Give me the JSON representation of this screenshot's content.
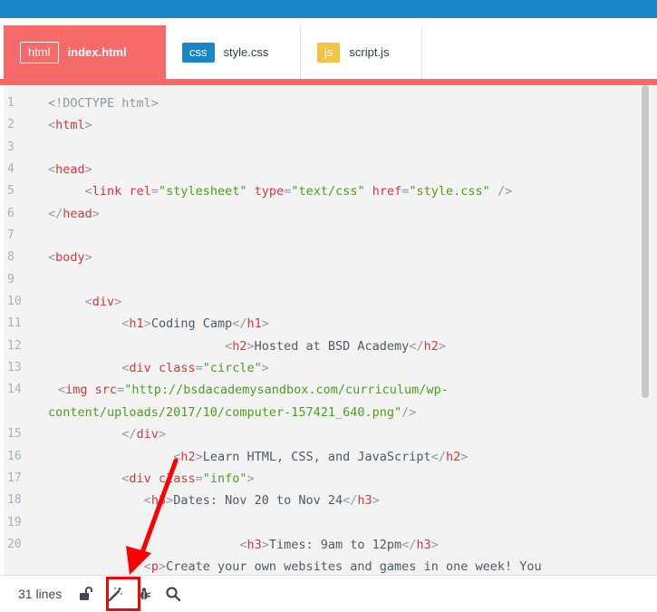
{
  "tabs": [
    {
      "badge": "html",
      "label": "index.html",
      "active": true,
      "badge_color": "#f76a6a"
    },
    {
      "badge": "css",
      "label": "style.css",
      "active": false,
      "badge_color": "#1a86c8"
    },
    {
      "badge": "js",
      "label": "script.js",
      "active": false,
      "badge_color": "#f5c343"
    }
  ],
  "code_lines": [
    {
      "n": "1"
    },
    {
      "n": "2"
    },
    {
      "n": "3"
    },
    {
      "n": "4"
    },
    {
      "n": "5"
    },
    {
      "n": "6"
    },
    {
      "n": "7"
    },
    {
      "n": "8"
    },
    {
      "n": "9"
    },
    {
      "n": "10"
    },
    {
      "n": "11"
    },
    {
      "n": "12"
    },
    {
      "n": "13"
    },
    {
      "n": "14"
    },
    {
      "n": "15"
    },
    {
      "n": "16"
    },
    {
      "n": "17"
    },
    {
      "n": "18"
    },
    {
      "n": "19"
    },
    {
      "n": "20"
    }
  ],
  "code": {
    "l1": {
      "a": "<!DOCTYPE html>"
    },
    "l5": {
      "attr1": "rel",
      "val1": "\"stylesheet\"",
      "attr2": "type",
      "val2": "\"text/css\"",
      "attr3": "href",
      "val3": "\"style.css\""
    },
    "l11": {
      "text": "Coding Camp"
    },
    "l12": {
      "text": "Hosted at BSD Academy"
    },
    "l13": {
      "attr": "class",
      "val": "\"circle\""
    },
    "l14": {
      "attr": "src",
      "val_a": "\"http://bsdacademysandbox.com/curriculum/wp-",
      "val_b": "content/uploads/2017/10/computer-157421_640.png\""
    },
    "l16": {
      "text": "Learn HTML, CSS, and JavaScript"
    },
    "l17": {
      "attr": "class",
      "val": "\"info\""
    },
    "l18": {
      "text": "Dates: Nov 20 to Nov 24"
    },
    "l20": {
      "text": "Times: 9am to 12pm"
    },
    "l21": {
      "text": "Create your own websites and games in one week! You"
    }
  },
  "bottom": {
    "lines_count": "31 lines",
    "icons": [
      "unlock-icon",
      "magic-wand-icon",
      "bug-icon",
      "search-icon"
    ]
  },
  "colors": {
    "accent_blue": "#1a86c8",
    "accent_red": "#f76a6a",
    "annotation_red": "#ff0000"
  }
}
